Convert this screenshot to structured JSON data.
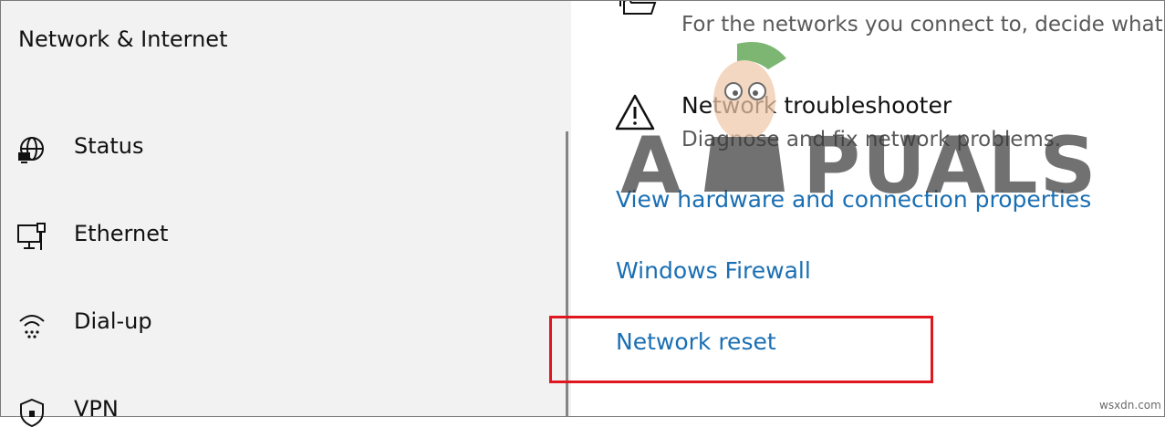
{
  "sidebar": {
    "title": "Network & Internet",
    "items": [
      {
        "label": "Status",
        "icon": "globe-icon"
      },
      {
        "label": "Ethernet",
        "icon": "ethernet-monitor-icon"
      },
      {
        "label": "Dial-up",
        "icon": "dialup-icon"
      },
      {
        "label": "VPN",
        "icon": "vpn-shield-icon"
      }
    ]
  },
  "main": {
    "sharing": {
      "desc": "For the networks you connect to, decide what",
      "icon": "sharing-folder-icon"
    },
    "troubleshooter": {
      "title": "Network troubleshooter",
      "desc": "Diagnose and fix network problems.",
      "icon": "warning-icon"
    },
    "links": [
      {
        "label": "View hardware and connection properties"
      },
      {
        "label": "Windows Firewall"
      },
      {
        "label": "Network reset"
      }
    ]
  },
  "highlight_color": "#e0171f",
  "link_color": "#1a6fb3",
  "watermark": "A PUALS",
  "credit": "wsxdn.com"
}
